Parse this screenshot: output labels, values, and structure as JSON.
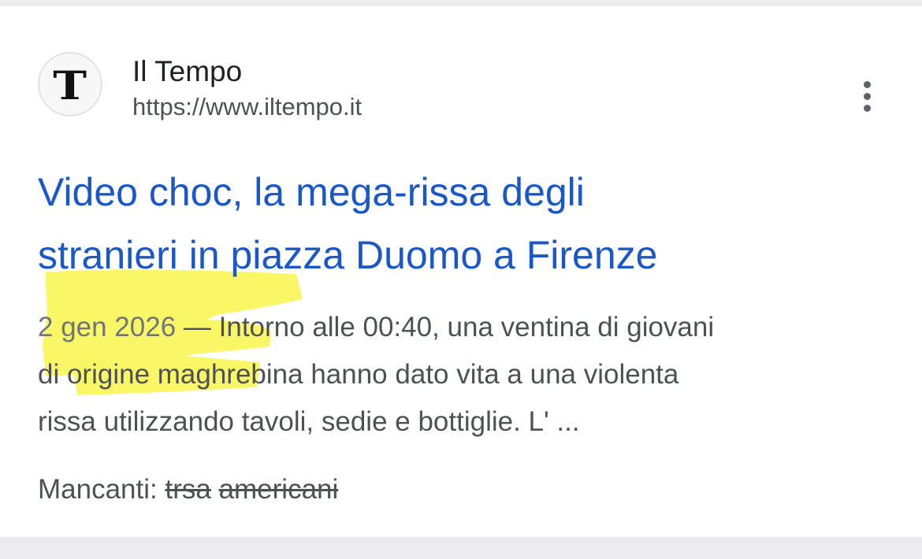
{
  "result": {
    "favicon_letter": "T",
    "site_name": "Il Tempo",
    "site_url": "https://www.iltempo.it",
    "more_icon": "more-vert-icon",
    "title_line1": "Video choc, la mega-rissa degli",
    "title_line2": "stranieri in piazza Duomo a Firenze",
    "date": "2 gen 2026",
    "dash": " — ",
    "snippet_line1": "Intorno alle 00:40, una ventina di giovani",
    "snippet_line2": "di origine maghrebina hanno dato vita a una violenta",
    "snippet_line3": "rissa utilizzando tavoli, sedie e bottiglie. L' ...",
    "missing_label": "Mancanti: ",
    "missing_term1": "trsa",
    "missing_term2": "americani"
  },
  "colors": {
    "title_link": "#1a57c9",
    "highlight": "#f7f53b",
    "background": "#ebebed"
  }
}
